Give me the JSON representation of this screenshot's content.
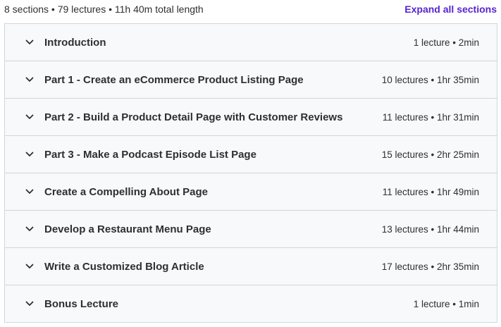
{
  "header": {
    "summary": "8 sections • 79 lectures • 11h 40m total length",
    "expand_all_label": "Expand all sections"
  },
  "sections": [
    {
      "title": "Introduction",
      "meta": "1 lecture • 2min",
      "icon": "chevron-down-icon"
    },
    {
      "title": "Part 1 - Create an eCommerce Product Listing Page",
      "meta": "10 lectures • 1hr 35min",
      "icon": "chevron-down-icon"
    },
    {
      "title": "Part 2 - Build a Product Detail Page with Customer Reviews",
      "meta": "11 lectures • 1hr 31min",
      "icon": "chevron-down-icon"
    },
    {
      "title": "Part 3 - Make a Podcast Episode List Page",
      "meta": "15 lectures • 2hr 25min",
      "icon": "chevron-down-icon"
    },
    {
      "title": "Create a Compelling About Page",
      "meta": "11 lectures • 1hr 49min",
      "icon": "chevron-down-icon"
    },
    {
      "title": "Develop a Restaurant Menu Page",
      "meta": "13 lectures • 1hr 44min",
      "icon": "chevron-down-icon"
    },
    {
      "title": "Write a Customized Blog Article",
      "meta": "17 lectures • 2hr 35min",
      "icon": "chevron-down-icon"
    },
    {
      "title": "Bonus Lecture",
      "meta": "1 lecture • 1min",
      "icon": "chevron-down-icon"
    }
  ],
  "colors": {
    "accent": "#5624d0",
    "section_bg": "#f7f9fa",
    "border": "#d1d7dc",
    "text": "#2d2f31"
  }
}
